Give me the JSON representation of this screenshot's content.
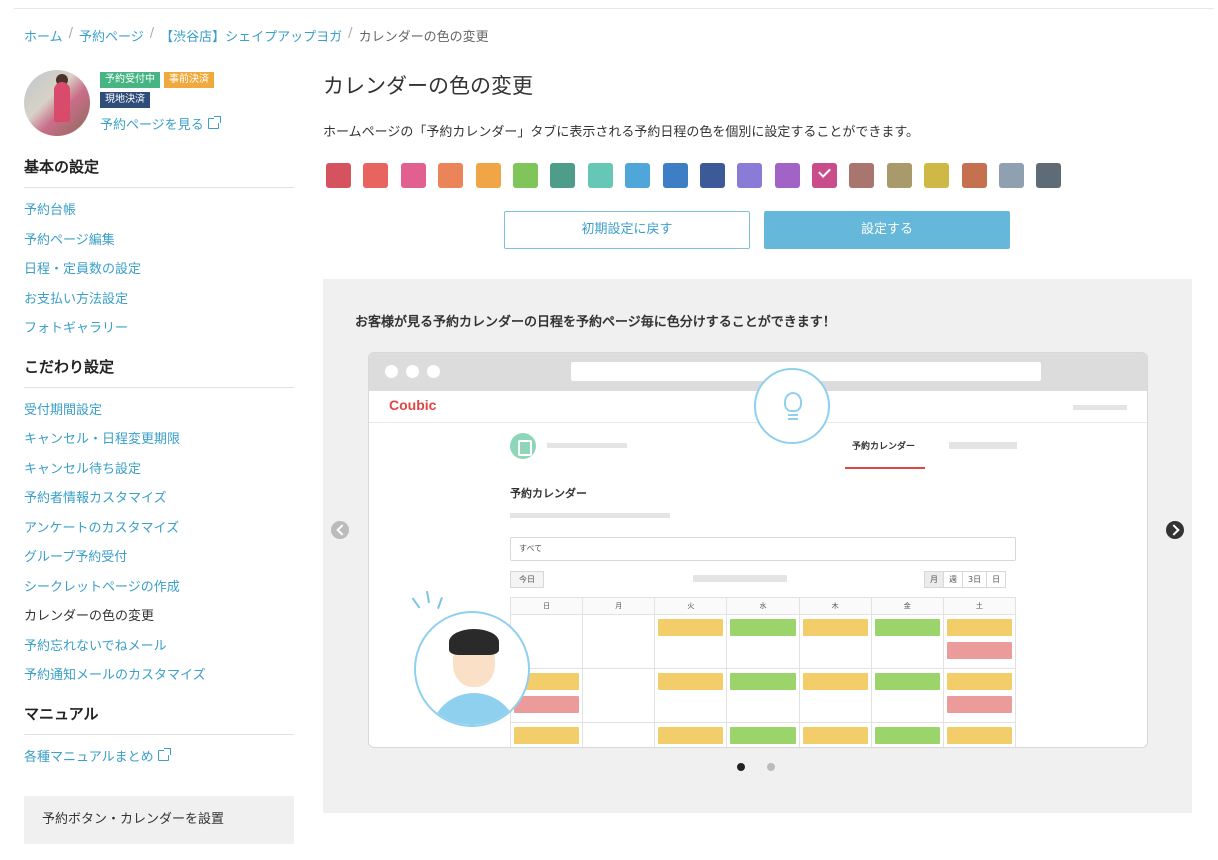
{
  "breadcrumb": {
    "items": [
      "ホーム",
      "予約ページ",
      "【渋谷店】シェイプアップヨガ"
    ],
    "current": "カレンダーの色の変更"
  },
  "profile": {
    "badges": [
      "予約受付中",
      "事前決済",
      "現地決済"
    ],
    "view_page_link": "予約ページを見る"
  },
  "sidebar": {
    "basic_title": "基本の設定",
    "basic_items": [
      "予約台帳",
      "予約ページ編集",
      "日程・定員数の設定",
      "お支払い方法設定",
      "フォトギャラリー"
    ],
    "advanced_title": "こだわり設定",
    "advanced_items": [
      "受付期間設定",
      "キャンセル・日程変更期限",
      "キャンセル待ち設定",
      "予約者情報カスタマイズ",
      "アンケートのカスタマイズ",
      "グループ予約受付",
      "シークレットページの作成",
      "カレンダーの色の変更",
      "予約忘れないでねメール",
      "予約通知メールのカスタマイズ"
    ],
    "manual_title": "マニュアル",
    "manual_link": "各種マニュアルまとめ",
    "install_button": "予約ボタン・カレンダーを設置"
  },
  "main": {
    "title": "カレンダーの色の変更",
    "description": "ホームページの「予約カレンダー」タブに表示される予約日程の色を個別に設定することができます。",
    "swatches": [
      "#d5525f",
      "#e8655f",
      "#e2608f",
      "#ec8459",
      "#f0a646",
      "#7fc55a",
      "#4e9d8a",
      "#67c7b7",
      "#4fa7d9",
      "#3d7ec5",
      "#3c5a97",
      "#8a7bd7",
      "#a263c6",
      "#c94d8a",
      "#a8766f",
      "#a89a6a",
      "#cfb946",
      "#c5714f",
      "#8fa0b1",
      "#5e6c78"
    ],
    "selected_swatch": 13,
    "reset_button": "初期設定に戻す",
    "set_button": "設定する"
  },
  "preview": {
    "caption": "お客様が見る予約カレンダーの日程を予約ページ毎に色分けすることができます！",
    "logo": "Coubic",
    "tab_label": "予約カレンダー",
    "calendar_title": "予約カレンダー",
    "filter": "すべて",
    "today_button": "今日",
    "views": [
      "月",
      "週",
      "3日",
      "日"
    ],
    "weekdays": [
      "日",
      "月",
      "火",
      "水",
      "木",
      "金",
      "土"
    ],
    "slide_count": 2,
    "active_slide": 0
  }
}
